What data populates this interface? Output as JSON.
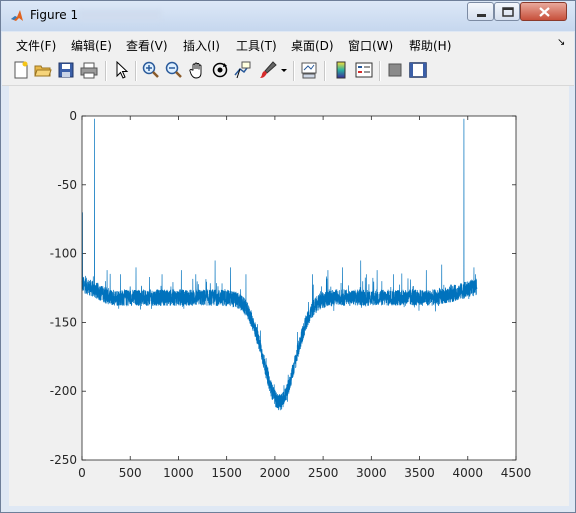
{
  "window": {
    "title": "Figure 1"
  },
  "menu": [
    "文件(F)",
    "编辑(E)",
    "查看(V)",
    "插入(I)",
    "工具(T)",
    "桌面(D)",
    "窗口(W)",
    "帮助(H)"
  ],
  "toolbar": {
    "icons": [
      "new-figure-icon",
      "open-file-icon",
      "save-icon",
      "print-icon",
      "edit-plot-icon",
      "zoom-in-icon",
      "zoom-out-icon",
      "pan-icon",
      "rotate-3d-icon",
      "data-cursor-icon",
      "brush-icon",
      "link-plot-icon",
      "insert-colorbar-icon",
      "insert-legend-icon",
      "hide-plot-tools-icon",
      "show-plot-tools-icon"
    ]
  },
  "chart_data": {
    "type": "line",
    "xlim": [
      0,
      4500
    ],
    "ylim": [
      -250,
      0
    ],
    "xticks": [
      "0",
      "500",
      "1000",
      "1500",
      "2000",
      "2500",
      "3000",
      "3500",
      "4000",
      "4500"
    ],
    "yticks": [
      "0",
      "-50",
      "-100",
      "-150",
      "-200",
      "-250"
    ],
    "color": "#0072BD",
    "n_points": 4096,
    "baseline": -132,
    "noise": 6,
    "dip": {
      "center": 2048,
      "depth": -208,
      "width": 220
    },
    "spikes": [
      {
        "x": 5,
        "y": -70
      },
      {
        "x": 130,
        "y": -2
      },
      {
        "x": 260,
        "y": -112
      },
      {
        "x": 400,
        "y": -115
      },
      {
        "x": 560,
        "y": -110
      },
      {
        "x": 700,
        "y": -117
      },
      {
        "x": 830,
        "y": -115
      },
      {
        "x": 1030,
        "y": -112
      },
      {
        "x": 1180,
        "y": -115
      },
      {
        "x": 1380,
        "y": -105
      },
      {
        "x": 1540,
        "y": -110
      },
      {
        "x": 1700,
        "y": -115
      },
      {
        "x": 2390,
        "y": -115
      },
      {
        "x": 2550,
        "y": -112
      },
      {
        "x": 2700,
        "y": -110
      },
      {
        "x": 2890,
        "y": -105
      },
      {
        "x": 3060,
        "y": -112
      },
      {
        "x": 3230,
        "y": -115
      },
      {
        "x": 3380,
        "y": -118
      },
      {
        "x": 3570,
        "y": -112
      },
      {
        "x": 3730,
        "y": -108
      },
      {
        "x": 3960,
        "y": -2
      },
      {
        "x": 4080,
        "y": -115
      }
    ]
  }
}
